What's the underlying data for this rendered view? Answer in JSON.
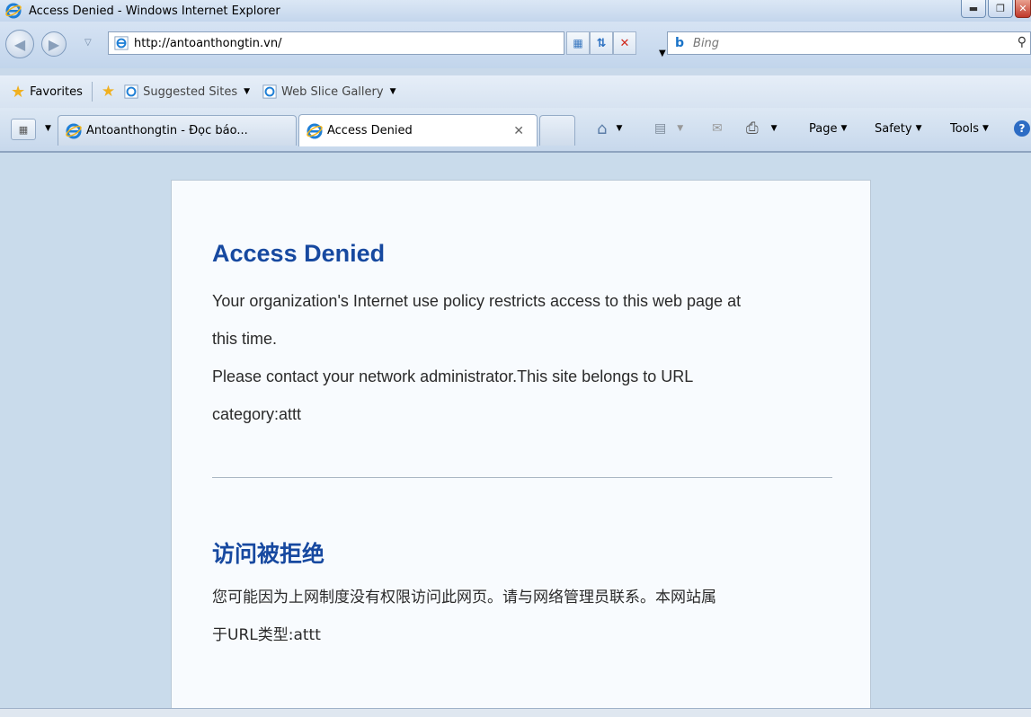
{
  "window": {
    "title": "Access Denied - Windows Internet Explorer",
    "buttons": [
      "minimize",
      "restore",
      "close"
    ]
  },
  "navigation": {
    "url_prefix": "http://",
    "url_host": "antoanthongtin.vn",
    "url_suffix": "/",
    "search_placeholder": "Bing"
  },
  "favorites_bar": {
    "favorites_label": "Favorites",
    "suggested_sites": "Suggested Sites",
    "web_slice_gallery": "Web Slice Gallery"
  },
  "tabs": [
    {
      "label": "Antoanthongtin - Đọc báo...",
      "active": false
    },
    {
      "label": "Access Denied",
      "active": true
    }
  ],
  "command_bar": {
    "page": "Page",
    "safety": "Safety",
    "tools": "Tools"
  },
  "page": {
    "title_en": "Access Denied",
    "message_en_line1": "Your organization's Internet use policy restricts access to this web page at",
    "message_en_line2": "this time.",
    "message_en_line3": "Please contact your network administrator.This site belongs to URL",
    "message_en_line4": "category:attt",
    "title_zh": "访问被拒绝",
    "message_zh_line1": "您可能因为上网制度没有权限访问此网页。请与网络管理员联系。本网站属",
    "message_zh_line2": "于URL类型:attt"
  },
  "colors": {
    "heading": "#1749a0",
    "page_bg": "#c9dbeb",
    "card_bg": "#f8fbfe"
  }
}
